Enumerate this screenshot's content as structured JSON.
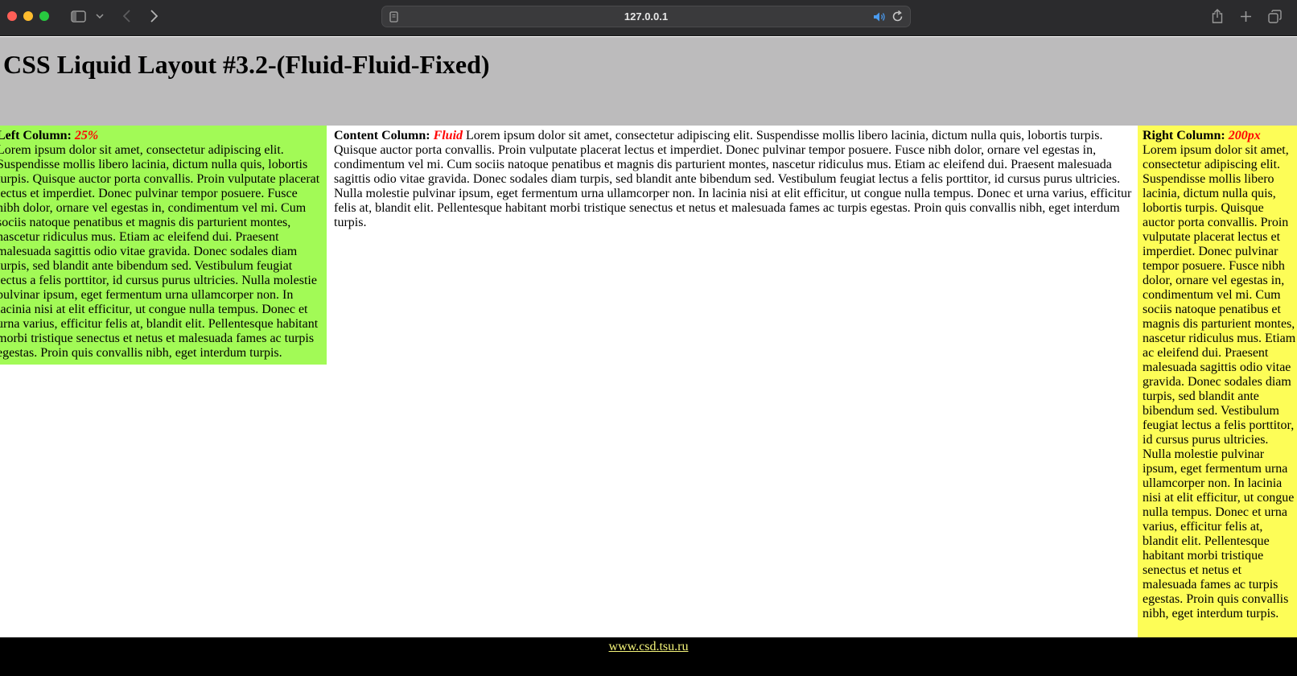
{
  "browser": {
    "url": "127.0.0.1",
    "icons": [
      "close-window-icon",
      "minimize-window-icon",
      "zoom-window-icon",
      "sidebar-icon",
      "chevron-down-icon",
      "back-icon",
      "forward-icon",
      "page-icon",
      "audio-icon",
      "reload-icon",
      "share-icon",
      "new-tab-icon",
      "tab-overview-icon"
    ]
  },
  "header": {
    "title": "CSS Liquid Layout #3.2-(Fluid-Fluid-Fixed)"
  },
  "left": {
    "label": "Left Column:",
    "tag": "25%",
    "text": "Lorem ipsum dolor sit amet, consectetur adipiscing elit. Suspendisse mollis libero lacinia, dictum nulla quis, lobortis turpis. Quisque auctor porta convallis. Proin vulputate placerat lectus et imperdiet. Donec pulvinar tempor posuere. Fusce nibh dolor, ornare vel egestas in, condimentum vel mi. Cum sociis natoque penatibus et magnis dis parturient montes, nascetur ridiculus mus. Etiam ac eleifend dui. Praesent malesuada sagittis odio vitae gravida. Donec sodales diam turpis, sed blandit ante bibendum sed. Vestibulum feugiat lectus a felis porttitor, id cursus purus ultricies. Nulla molestie pulvinar ipsum, eget fermentum urna ullamcorper non. In lacinia nisi at elit efficitur, ut congue nulla tempus. Donec et urna varius, efficitur felis at, blandit elit. Pellentesque habitant morbi tristique senectus et netus et malesuada fames ac turpis egestas. Proin quis convallis nibh, eget interdum turpis."
  },
  "content": {
    "label": "Content Column:",
    "tag": "Fluid",
    "text": "Lorem ipsum dolor sit amet, consectetur adipiscing elit. Suspendisse mollis libero lacinia, dictum nulla quis, lobortis turpis. Quisque auctor porta convallis. Proin vulputate placerat lectus et imperdiet. Donec pulvinar tempor posuere. Fusce nibh dolor, ornare vel egestas in, condimentum vel mi. Cum sociis natoque penatibus et magnis dis parturient montes, nascetur ridiculus mus. Etiam ac eleifend dui. Praesent malesuada sagittis odio vitae gravida. Donec sodales diam turpis, sed blandit ante bibendum sed. Vestibulum feugiat lectus a felis porttitor, id cursus purus ultricies. Nulla molestie pulvinar ipsum, eget fermentum urna ullamcorper non. In lacinia nisi at elit efficitur, ut congue nulla tempus. Donec et urna varius, efficitur felis at, blandit elit. Pellentesque habitant morbi tristique senectus et netus et malesuada fames ac turpis egestas. Proin quis convallis nibh, eget interdum turpis."
  },
  "right": {
    "label": "Right Column:",
    "tag": "200px",
    "text": "Lorem ipsum dolor sit amet, consectetur adipiscing elit. Suspendisse mollis libero lacinia, dictum nulla quis, lobortis turpis. Quisque auctor porta convallis. Proin vulputate placerat lectus et imperdiet. Donec pulvinar tempor posuere. Fusce nibh dolor, ornare vel egestas in, condimentum vel mi. Cum sociis natoque penatibus et magnis dis parturient montes, nascetur ridiculus mus. Etiam ac eleifend dui. Praesent malesuada sagittis odio vitae gravida. Donec sodales diam turpis, sed blandit ante bibendum sed. Vestibulum feugiat lectus a felis porttitor, id cursus purus ultricies. Nulla molestie pulvinar ipsum, eget fermentum urna ullamcorper non. In lacinia nisi at elit efficitur, ut congue nulla tempus. Donec et urna varius, efficitur felis at, blandit elit. Pellentesque habitant morbi tristique senectus et netus et malesuada fames ac turpis egestas. Proin quis convallis nibh, eget interdum turpis."
  },
  "footer": {
    "link": "www.csd.tsu.ru"
  },
  "colors": {
    "header_bg": "#bcbbbc",
    "left_bg": "#a2fa56",
    "right_bg": "#fdfd57",
    "footer_bg": "#000000",
    "accent": "#ff0000",
    "link": "#f5f57a"
  }
}
